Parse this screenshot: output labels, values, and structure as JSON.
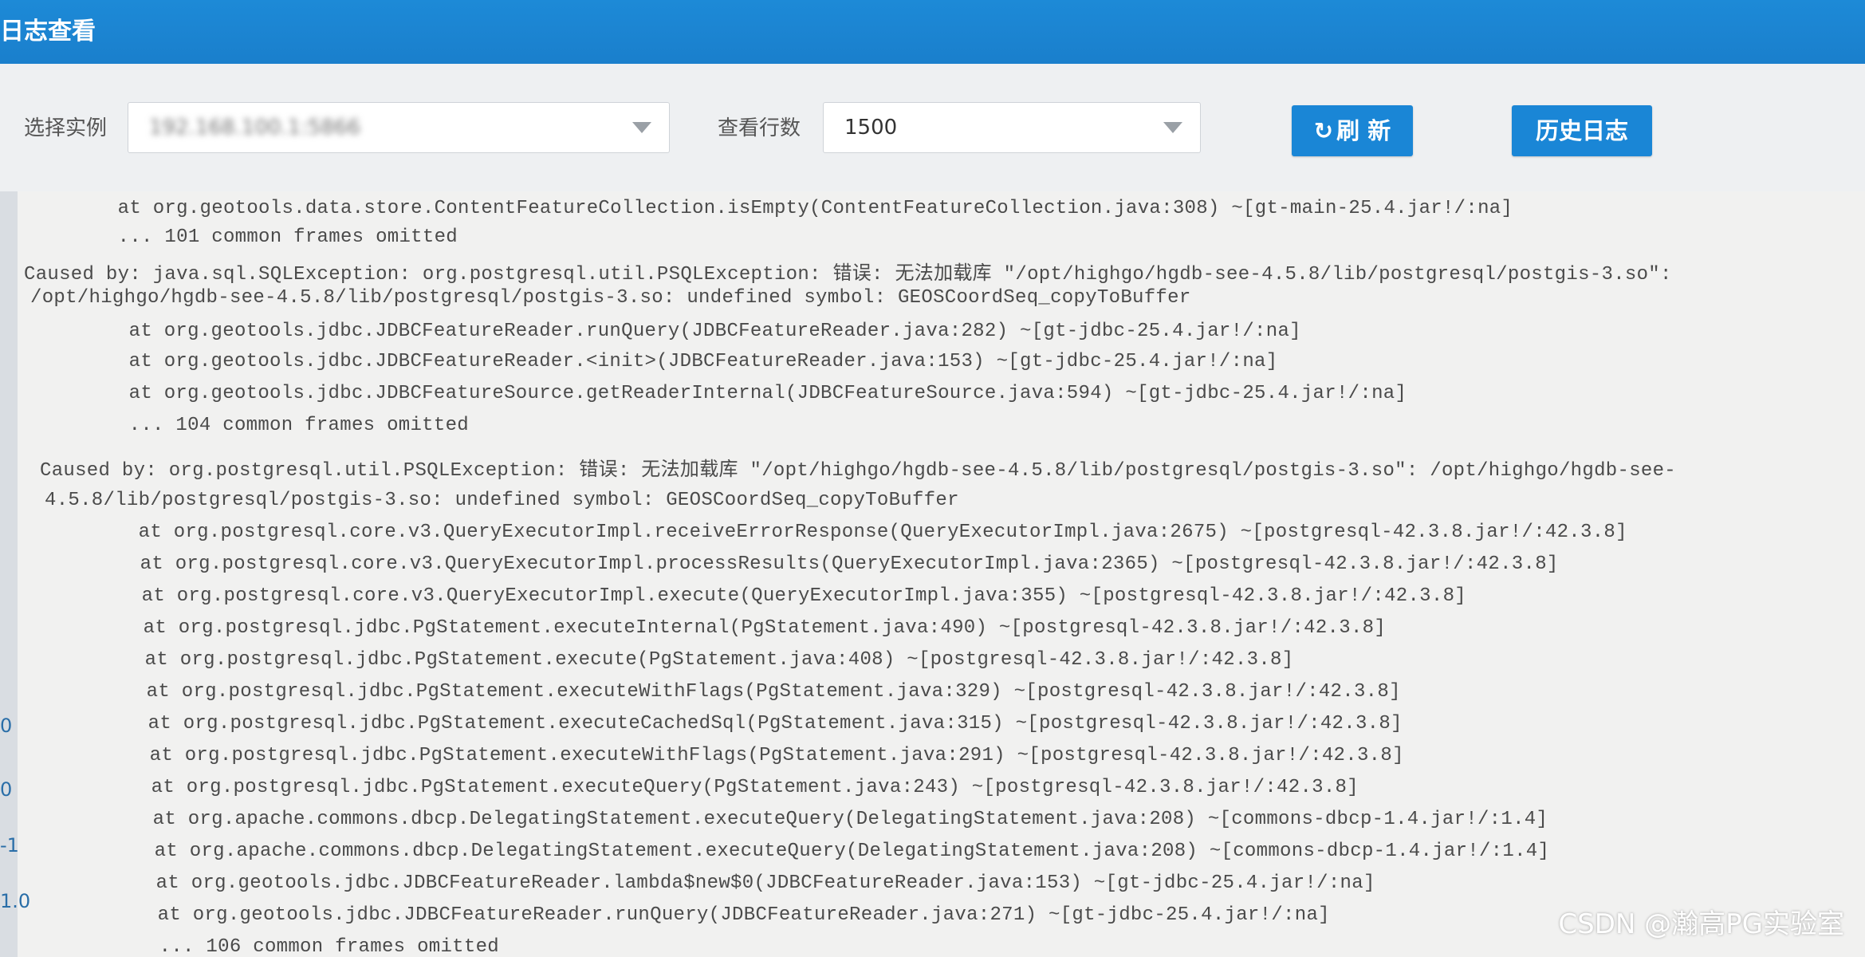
{
  "window": {
    "title": "日志查看"
  },
  "toolbar": {
    "instance_label": "选择实例",
    "instance_value": "192.168.100.1:5866",
    "rows_label": "查看行数",
    "rows_value": "1500",
    "refresh_label": "刷 新",
    "history_label": "历史日志"
  },
  "log": {
    "lines": [
      "        at org.geotools.data.store.ContentFeatureCollection.isEmpty(ContentFeatureCollection.java:308) ~[gt-main-25.4.jar!/:na]",
      "        ... 101 common frames omitted",
      "Caused by: java.sql.SQLException: org.postgresql.util.PSQLException: 错误: 无法加载库 \"/opt/highgo/hgdb-see-4.5.8/lib/postgresql/postgis-3.so\":",
      "/opt/highgo/hgdb-see-4.5.8/lib/postgresql/postgis-3.so: undefined symbol: GEOSCoordSeq_copyToBuffer",
      "        at org.geotools.jdbc.JDBCFeatureReader.runQuery(JDBCFeatureReader.java:282) ~[gt-jdbc-25.4.jar!/:na]",
      "        at org.geotools.jdbc.JDBCFeatureReader.<init>(JDBCFeatureReader.java:153) ~[gt-jdbc-25.4.jar!/:na]",
      "        at org.geotools.jdbc.JDBCFeatureSource.getReaderInternal(JDBCFeatureSource.java:594) ~[gt-jdbc-25.4.jar!/:na]",
      "        ... 104 common frames omitted",
      "Caused by: org.postgresql.util.PSQLException: 错误: 无法加载库 \"/opt/highgo/hgdb-see-4.5.8/lib/postgresql/postgis-3.so\": /opt/highgo/hgdb-see-",
      "4.5.8/lib/postgresql/postgis-3.so: undefined symbol: GEOSCoordSeq_copyToBuffer",
      "        at org.postgresql.core.v3.QueryExecutorImpl.receiveErrorResponse(QueryExecutorImpl.java:2675) ~[postgresql-42.3.8.jar!/:42.3.8]",
      "        at org.postgresql.core.v3.QueryExecutorImpl.processResults(QueryExecutorImpl.java:2365) ~[postgresql-42.3.8.jar!/:42.3.8]",
      "        at org.postgresql.core.v3.QueryExecutorImpl.execute(QueryExecutorImpl.java:355) ~[postgresql-42.3.8.jar!/:42.3.8]",
      "        at org.postgresql.jdbc.PgStatement.executeInternal(PgStatement.java:490) ~[postgresql-42.3.8.jar!/:42.3.8]",
      "        at org.postgresql.jdbc.PgStatement.execute(PgStatement.java:408) ~[postgresql-42.3.8.jar!/:42.3.8]",
      "        at org.postgresql.jdbc.PgStatement.executeWithFlags(PgStatement.java:329) ~[postgresql-42.3.8.jar!/:42.3.8]",
      "        at org.postgresql.jdbc.PgStatement.executeCachedSql(PgStatement.java:315) ~[postgresql-42.3.8.jar!/:42.3.8]",
      "        at org.postgresql.jdbc.PgStatement.executeWithFlags(PgStatement.java:291) ~[postgresql-42.3.8.jar!/:42.3.8]",
      "        at org.postgresql.jdbc.PgStatement.executeQuery(PgStatement.java:243) ~[postgresql-42.3.8.jar!/:42.3.8]",
      "        at org.apache.commons.dbcp.DelegatingStatement.executeQuery(DelegatingStatement.java:208) ~[commons-dbcp-1.4.jar!/:1.4]",
      "        at org.apache.commons.dbcp.DelegatingStatement.executeQuery(DelegatingStatement.java:208) ~[commons-dbcp-1.4.jar!/:1.4]",
      "        at org.geotools.jdbc.JDBCFeatureReader.lambda$new$0(JDBCFeatureReader.java:153) ~[gt-jdbc-25.4.jar!/:na]",
      "        at org.geotools.jdbc.JDBCFeatureReader.runQuery(JDBCFeatureReader.java:271) ~[gt-jdbc-25.4.jar!/:na]",
      "        ... 106 common frames omitted"
    ]
  },
  "gutter": {
    "numbers": [
      "0",
      "0",
      "-1",
      "1.0"
    ]
  },
  "watermark": "CSDN @瀚高PG实验室"
}
